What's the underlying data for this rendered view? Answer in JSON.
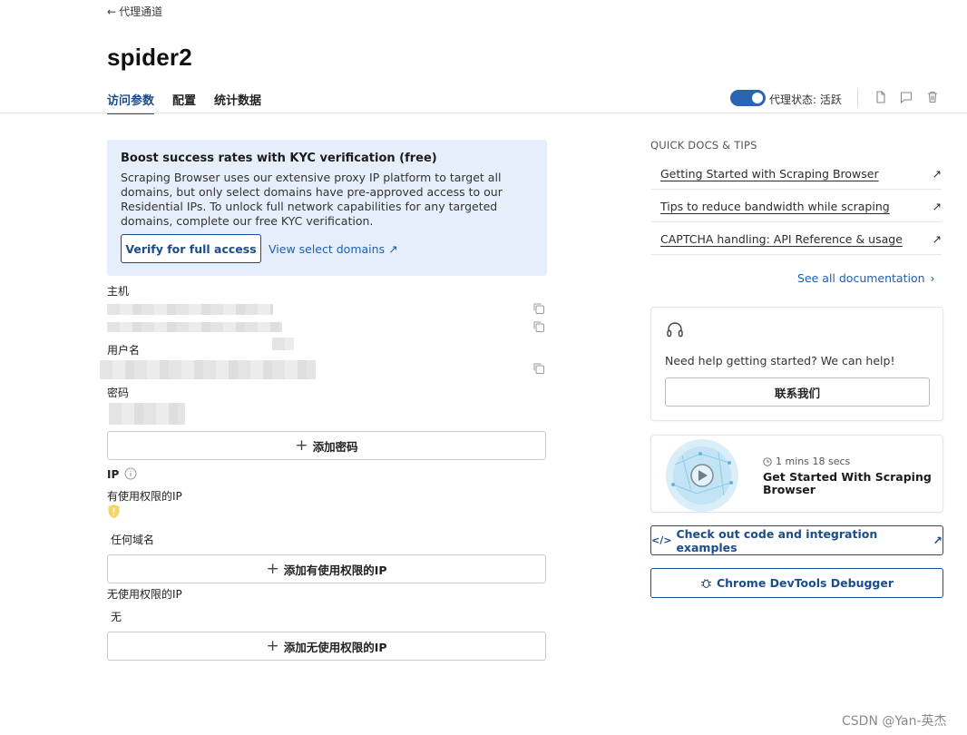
{
  "header": {
    "back_label": "代理通道",
    "title": "spider2",
    "tabs": [
      {
        "label": "访问参数",
        "active": true
      },
      {
        "label": "配置",
        "active": false
      },
      {
        "label": "统计数据",
        "active": false
      }
    ],
    "proxy_status_label": "代理状态: 活跃",
    "proxy_active": true,
    "accent_color": "#1b4c8b"
  },
  "kyc": {
    "title": "Boost success rates with KYC verification (free)",
    "body": "Scraping Browser uses our extensive proxy IP platform to target all domains, but only select domains have pre-approved access to our Residential IPs. To unlock full network capabilities for any targeted domains, complete our free KYC verification.",
    "verify_button": "Verify for full access",
    "domains_link": "View select domains"
  },
  "credentials": {
    "host_label": "主机",
    "username_label": "用户名",
    "password_label": "密码",
    "add_password_button": "添加密码"
  },
  "ip": {
    "label": "IP",
    "allowed_label": "有使用权限的IP",
    "allowed_value": "任何域名",
    "add_allowed_button": "添加有使用权限的IP",
    "denied_label": "无使用权限的IP",
    "denied_value": "无",
    "add_denied_button": "添加无使用权限的IP"
  },
  "docs": {
    "heading": "QUICK DOCS & TIPS",
    "links": [
      "Getting Started with Scraping Browser",
      "Tips to reduce bandwidth while scraping",
      "CAPTCHA handling: API Reference & usage"
    ],
    "see_all": "See all documentation"
  },
  "help": {
    "text": "Need help getting started? We can help!",
    "contact_button": "联系我们"
  },
  "video": {
    "duration": "1 mins 18 secs",
    "title": "Get Started With Scraping Browser"
  },
  "actions": {
    "code_examples": "Check out code and integration examples",
    "devtools": "Chrome DevTools Debugger"
  },
  "watermark": "CSDN @Yan-英杰"
}
